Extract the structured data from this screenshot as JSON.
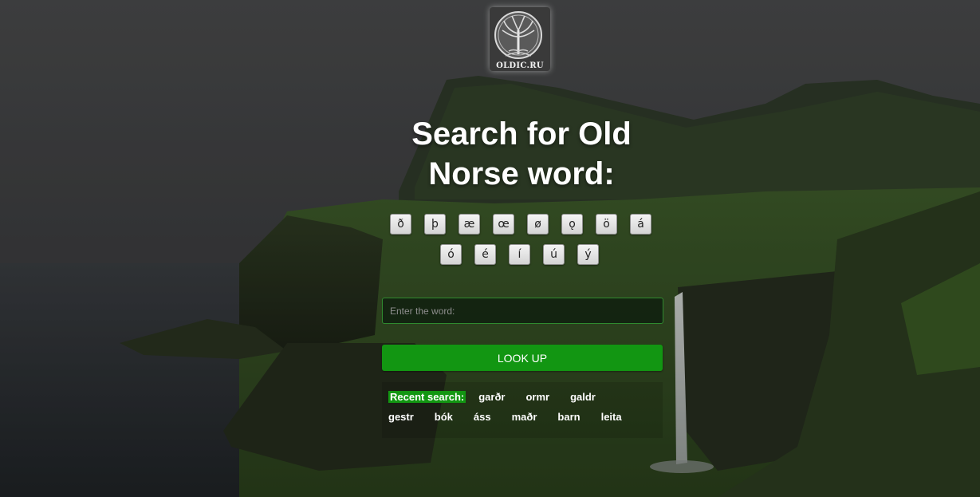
{
  "logo": {
    "text": "OLDIC.RU",
    "icon": "tree-of-life-icon"
  },
  "title": "Search for Old Norse word:",
  "special_chars": {
    "row1": [
      "ð",
      "þ",
      "æ",
      "œ",
      "ø",
      "ǫ",
      "ö",
      "á"
    ],
    "row2": [
      "ó",
      "é",
      "í",
      "ú",
      "ý"
    ]
  },
  "search": {
    "placeholder": "Enter the word:",
    "value": ""
  },
  "lookup_button": {
    "label": "LOOK UP"
  },
  "recent": {
    "label": "Recent search:",
    "row1": [
      "garðr",
      "ormr",
      "galdr"
    ],
    "row2": [
      "gestr",
      "bók",
      "áss",
      "maðr",
      "barn",
      "leita"
    ]
  },
  "colors": {
    "accent_green": "#129612",
    "input_border": "#2f8a2f",
    "title_text": "#ffffff"
  }
}
